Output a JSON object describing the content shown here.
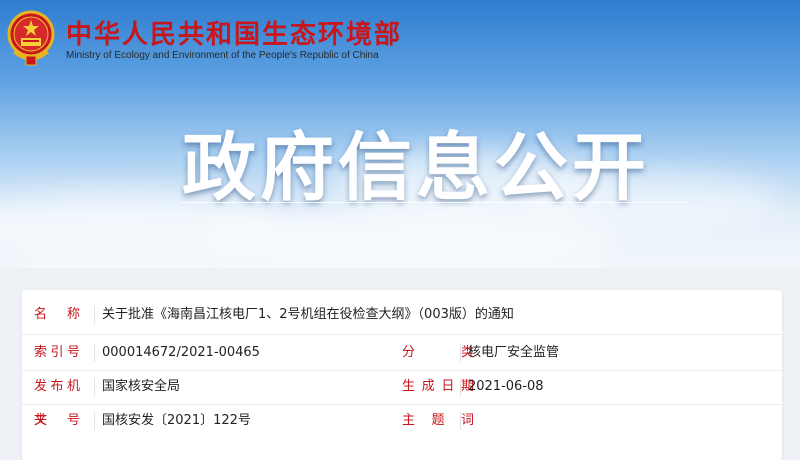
{
  "header": {
    "ministry_cn": "中华人民共和国生态环境部",
    "ministry_en": "Ministry of Ecology and Environment of the People's Republic of China",
    "banner_title": "政府信息公开"
  },
  "info": {
    "name_label": "名　称",
    "name_value": "关于批准《海南昌江核电厂1、2号机组在役检查大纲》（003版）的通知",
    "index_label": "索引号",
    "index_value": "000014672/2021-00465",
    "category_label": "分　类",
    "category_value": "核电厂安全监管",
    "issuer_label": "发布机关",
    "issuer_value": "国家核安全局",
    "date_label": "生成日期",
    "date_value": "2021-06-08",
    "docno_label": "文　号",
    "docno_value": "国核安发〔2021〕122号",
    "keywords_label": "主题词",
    "keywords_value": ""
  },
  "colors": {
    "label_red": "#c8161d",
    "sky_blue": "#2f7dd0"
  },
  "icons": {
    "emblem": "national-emblem-icon"
  }
}
